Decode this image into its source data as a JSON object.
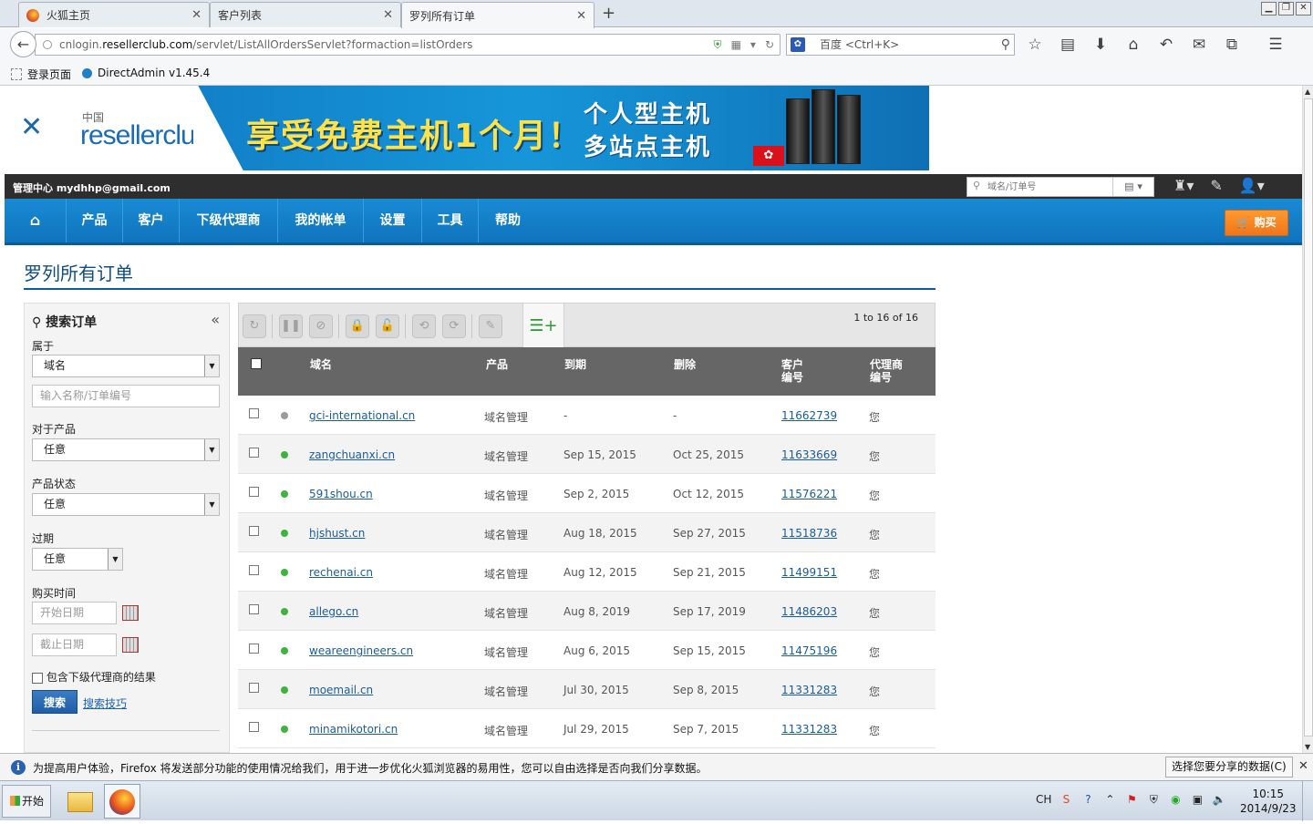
{
  "browser": {
    "tabs": [
      {
        "label": "火狐主页"
      },
      {
        "label": "客户列表"
      },
      {
        "label": "罗列所有订单"
      }
    ],
    "url_prefix": "cnlogin.",
    "url_domain": "resellerclub.com",
    "url_path": "/servlet/ListAllOrdersServlet?formaction=listOrders",
    "search_placeholder": "百度 <Ctrl+K>",
    "search_engine_icon": "paw-icon",
    "bookmarks": [
      {
        "label": "登录页面"
      },
      {
        "label": "DirectAdmin v1.45.4"
      }
    ]
  },
  "banner": {
    "logo_cn": "中国",
    "logo_text": "resellerclub",
    "ad_main": "享受免费主机1个月！",
    "ad_line1": "个人型主机",
    "ad_line2": "多站点主机"
  },
  "topstrip": {
    "who": "管理中心 mydhhp@gmail.com",
    "search_placeholder": "域名/订单号"
  },
  "nav": {
    "items": [
      "产品",
      "客户",
      "下级代理商",
      "我的帐单",
      "设置",
      "工具",
      "帮助"
    ],
    "buy_label": "购买"
  },
  "page": {
    "title": "罗列所有订单"
  },
  "filter": {
    "title": "搜索订单",
    "belongs_label": "属于",
    "belongs_value": "域名",
    "name_placeholder": "输入名称/订单编号",
    "product_label": "对于产品",
    "product_value": "任意",
    "status_label": "产品状态",
    "status_value": "任意",
    "expiry_label": "过期",
    "expiry_value": "任意",
    "purchase_label": "购买时间",
    "start_placeholder": "开始日期",
    "end_placeholder": "截止日期",
    "include_sub_label": "包含下级代理商的结果",
    "search_button": "搜索",
    "tips_link": "搜索技巧"
  },
  "table": {
    "page_count": "1 to 16 of 16",
    "headers": {
      "domain": "域名",
      "product": "产品",
      "expiry": "到期",
      "delete": "删除",
      "customer_id_1": "客户",
      "customer_id_2": "编号",
      "reseller_id_1": "代理商",
      "reseller_id_2": "编号"
    },
    "rows": [
      {
        "domain": "gci-international.cn",
        "product": "域名管理",
        "expiry": "-",
        "delete": "-",
        "customer": "11662739",
        "reseller": "您",
        "status": "grey"
      },
      {
        "domain": "zangchuanxi.cn",
        "product": "域名管理",
        "expiry": "Sep 15, 2015",
        "delete": "Oct 25, 2015",
        "customer": "11633669",
        "reseller": "您",
        "status": "green"
      },
      {
        "domain": "591shou.cn",
        "product": "域名管理",
        "expiry": "Sep 2, 2015",
        "delete": "Oct 12, 2015",
        "customer": "11576221",
        "reseller": "您",
        "status": "green"
      },
      {
        "domain": "hjshust.cn",
        "product": "域名管理",
        "expiry": "Aug 18, 2015",
        "delete": "Sep 27, 2015",
        "customer": "11518736",
        "reseller": "您",
        "status": "green"
      },
      {
        "domain": "rechenai.cn",
        "product": "域名管理",
        "expiry": "Aug 12, 2015",
        "delete": "Sep 21, 2015",
        "customer": "11499151",
        "reseller": "您",
        "status": "green"
      },
      {
        "domain": "allego.cn",
        "product": "域名管理",
        "expiry": "Aug 8, 2019",
        "delete": "Sep 17, 2019",
        "customer": "11486203",
        "reseller": "您",
        "status": "green"
      },
      {
        "domain": "weareengineers.cn",
        "product": "域名管理",
        "expiry": "Aug 6, 2015",
        "delete": "Sep 15, 2015",
        "customer": "11475196",
        "reseller": "您",
        "status": "green"
      },
      {
        "domain": "moemail.cn",
        "product": "域名管理",
        "expiry": "Jul 30, 2015",
        "delete": "Sep 8, 2015",
        "customer": "11331283",
        "reseller": "您",
        "status": "green"
      },
      {
        "domain": "minamikotori.cn",
        "product": "域名管理",
        "expiry": "Jul 29, 2015",
        "delete": "Sep 7, 2015",
        "customer": "11331283",
        "reseller": "您",
        "status": "green"
      }
    ]
  },
  "notification": {
    "message": "为提高用户体验，Firefox 将发送部分功能的使用情况给我们，用于进一步优化火狐浏览器的易用性，您可以自由选择是否向我们分享数据。",
    "choose_button": "选择您要分享的数据(C)"
  },
  "taskbar": {
    "start_label": "开始",
    "ime": "CH",
    "time": "10:15",
    "date": "2014/9/23"
  },
  "colors": {
    "nav_blue": "#1a8ad4",
    "title_blue": "#0e4e83",
    "buy_orange": "#f0751a",
    "status_green": "#3eb33e",
    "status_grey": "#9a9a9a"
  }
}
